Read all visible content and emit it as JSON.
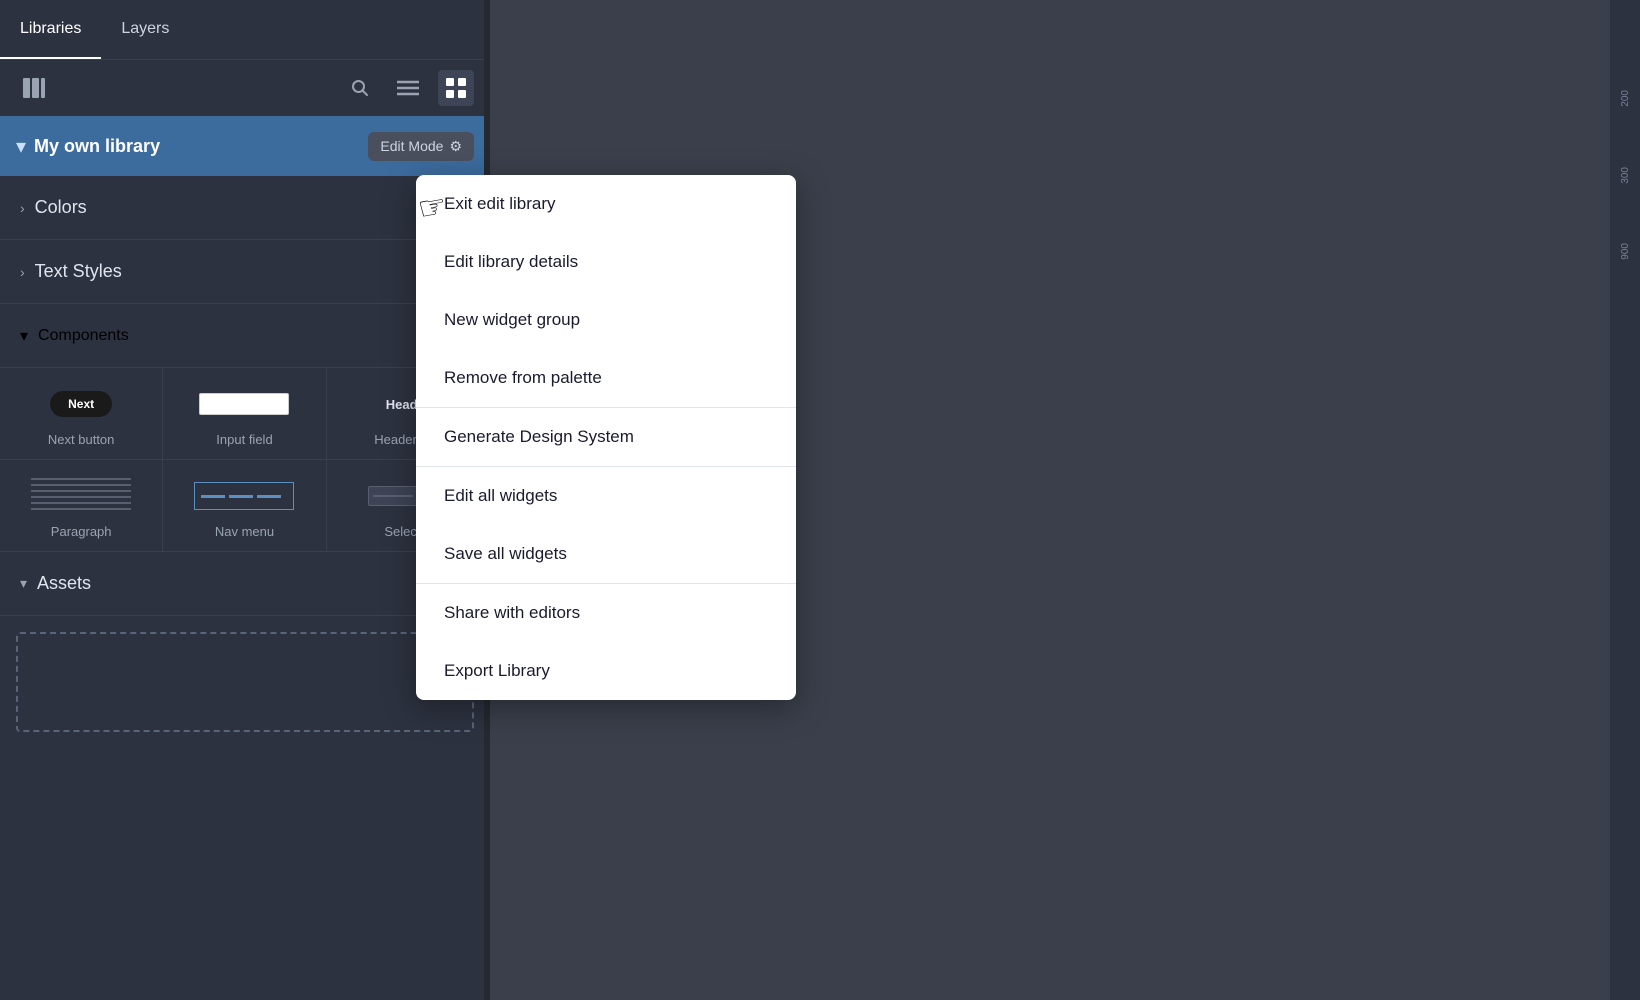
{
  "tabs": [
    {
      "id": "libraries",
      "label": "Libraries",
      "active": true
    },
    {
      "id": "layers",
      "label": "Layers",
      "active": false
    }
  ],
  "toolbar": {
    "library_icon": "▦",
    "search_icon": "🔍",
    "menu_icon": "≡",
    "grid_icon": "⊞"
  },
  "library": {
    "title": "My own library",
    "chevron": "▾",
    "edit_mode_label": "Edit Mode",
    "edit_mode_icon": "⚙"
  },
  "sections": [
    {
      "id": "colors",
      "label": "Colors",
      "chevron": "›",
      "expanded": false
    },
    {
      "id": "text_styles",
      "label": "Text Styles",
      "chevron": "›",
      "expanded": false
    },
    {
      "id": "components",
      "label": "Components",
      "chevron": "▾",
      "expanded": true
    },
    {
      "id": "assets",
      "label": "Assets",
      "chevron": "▾",
      "expanded": true
    }
  ],
  "components": [
    {
      "id": "next_button",
      "label": "Next button",
      "thumb_type": "next_btn"
    },
    {
      "id": "input_field",
      "label": "Input field",
      "thumb_type": "input"
    },
    {
      "id": "header_text",
      "label": "Header text",
      "thumb_type": "header"
    },
    {
      "id": "paragraph",
      "label": "Paragraph",
      "thumb_type": "paragraph"
    },
    {
      "id": "nav_menu",
      "label": "Nav menu",
      "thumb_type": "nav"
    },
    {
      "id": "select",
      "label": "Select...",
      "thumb_type": "select"
    }
  ],
  "header_label": "Header",
  "dropdown_menu": {
    "items": [
      {
        "id": "exit_edit",
        "label": "Exit edit library",
        "divider_after": false
      },
      {
        "id": "edit_details",
        "label": "Edit library details",
        "divider_after": false
      },
      {
        "id": "new_widget_group",
        "label": "New widget group",
        "divider_after": false
      },
      {
        "id": "remove_palette",
        "label": "Remove from palette",
        "divider_after": true
      },
      {
        "id": "generate_ds",
        "label": "Generate Design System",
        "divider_after": true
      },
      {
        "id": "edit_widgets",
        "label": "Edit all widgets",
        "divider_after": false
      },
      {
        "id": "save_widgets",
        "label": "Save all widgets",
        "divider_after": true
      },
      {
        "id": "share_editors",
        "label": "Share with editors",
        "divider_after": false
      },
      {
        "id": "export_library",
        "label": "Export Library",
        "divider_after": false
      }
    ]
  },
  "ruler": {
    "marks": [
      "200",
      "300",
      "900"
    ]
  }
}
